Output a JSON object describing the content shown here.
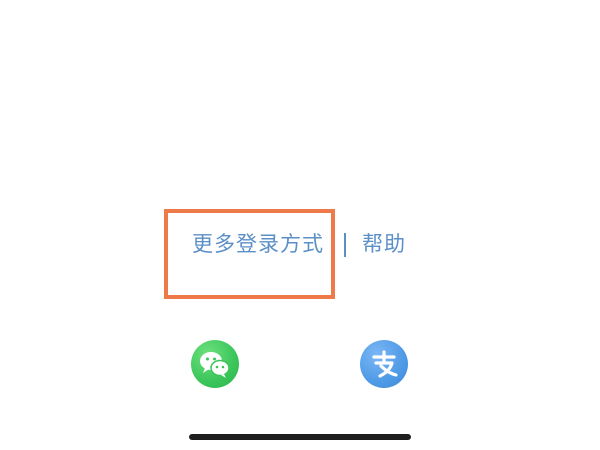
{
  "login_options": {
    "more_label": "更多登录方式",
    "help_label": "帮助"
  },
  "third_party": [
    {
      "icon": "wechat-icon",
      "color": "#3ac55a"
    },
    {
      "icon": "alipay-icon",
      "color": "#4e9ae6"
    }
  ],
  "colors": {
    "link": "#5b8fc7",
    "highlight": "#ee7a4a"
  }
}
